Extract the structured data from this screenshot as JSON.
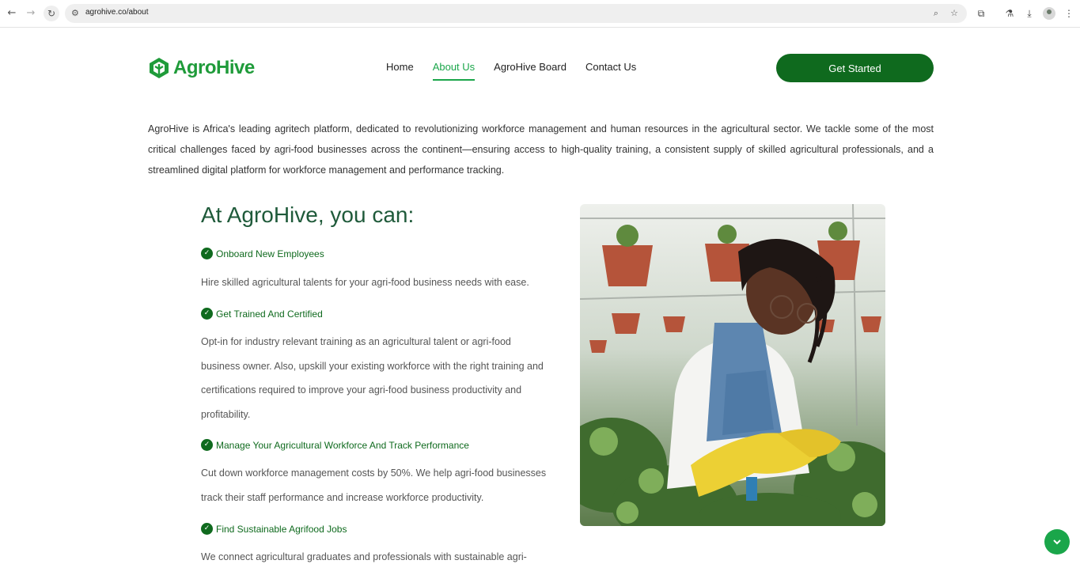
{
  "browser": {
    "url": "agrohive.co/about"
  },
  "header": {
    "logo_text": "AgroHive",
    "nav": [
      {
        "label": "Home"
      },
      {
        "label": "About Us"
      },
      {
        "label": "AgroHive Board"
      },
      {
        "label": "Contact Us"
      }
    ],
    "active_nav": "About Us",
    "cta_label": "Get Started"
  },
  "intro": "AgroHive is Africa's leading agritech platform, dedicated to revolutionizing workforce management and human resources in the agricultural sector. We tackle some of the most critical challenges faced by agri-food businesses across the continent—ensuring access to high-quality training, a consistent supply of skilled agricultural professionals, and a streamlined digital platform for workforce management and performance tracking.",
  "features": {
    "title": "At AgroHive, you can:",
    "items": [
      {
        "title": "Onboard New Employees",
        "description": "Hire skilled agricultural talents for your agri-food business needs with ease."
      },
      {
        "title": "Get Trained And Certified",
        "description": "Opt-in for industry relevant training as an agricultural talent or agri-food business owner. Also, upskill your existing workforce with the right training and certifications required to improve your agri-food business productivity and profitability."
      },
      {
        "title": "Manage Your Agricultural Workforce And Track Performance",
        "description": "Cut down workforce management costs by 50%. We help agri-food businesses track their staff performance and increase workforce productivity."
      },
      {
        "title": "Find Sustainable Agrifood Jobs",
        "description": "We connect agricultural graduates and professionals with sustainable agri-"
      }
    ]
  },
  "colors": {
    "brand_green": "#0f6a1e",
    "accent_green": "#1aa64a"
  }
}
